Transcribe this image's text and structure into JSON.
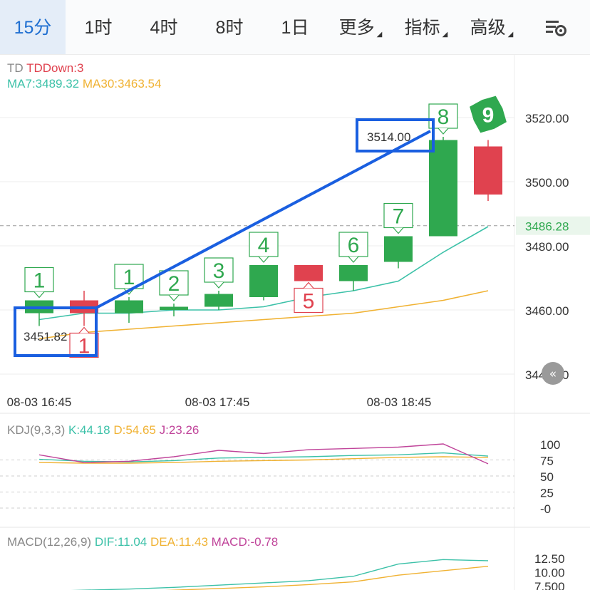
{
  "tabs": [
    {
      "label": "15分",
      "active": true
    },
    {
      "label": "1时"
    },
    {
      "label": "4时"
    },
    {
      "label": "8时"
    },
    {
      "label": "1日"
    },
    {
      "label": "更多",
      "dropdown": true
    },
    {
      "label": "指标",
      "dropdown": true
    },
    {
      "label": "高级",
      "dropdown": true
    }
  ],
  "settings_icon": "chart-settings-icon",
  "main_panel": {
    "td_label": "TD",
    "td_value": "TDDown:3",
    "ma7": "MA7:3489.32",
    "ma30": "MA30:3463.54",
    "last_price": "3486.28",
    "y_labels": [
      "3520.00",
      "3500.00",
      "3480.00",
      "3460.00",
      "3440.00"
    ],
    "x_labels": [
      "08-03 16:45",
      "08-03 17:45",
      "08-03 18:45"
    ],
    "annotation_low": "3451.82",
    "annotation_high": "3514.00"
  },
  "kdj_panel": {
    "title": "KDJ(9,3,3)",
    "k": "K:44.18",
    "d": "D:54.65",
    "j": "J:23.26",
    "y_labels": [
      "100",
      "75",
      "50",
      "25",
      "-0"
    ]
  },
  "macd_panel": {
    "title": "MACD(12,26,9)",
    "dif": "DIF:11.04",
    "dea": "DEA:11.43",
    "macd": "MACD:-0.78",
    "y_labels": [
      "12.50",
      "10.00",
      "7.500"
    ]
  },
  "colors": {
    "up": "#2fa84f",
    "down": "#e0424f",
    "ma7": "#3cc1a8",
    "ma30": "#f0b233",
    "kdj_j": "#c0449a",
    "accent": "#1f6fd1",
    "annotation_box": "#1a5fe0"
  },
  "chart_data": {
    "type": "candlestick",
    "price_axis": {
      "min": 3440,
      "max": 3520
    },
    "candles": [
      {
        "open": 3459,
        "high": 3463,
        "low": 3455,
        "close": 3463,
        "td": "1",
        "td_side": "up"
      },
      {
        "open": 3463,
        "high": 3466,
        "low": 3455,
        "close": 3459,
        "td": "1",
        "td_side": "down"
      },
      {
        "open": 3459,
        "high": 3464,
        "low": 3456,
        "close": 3463,
        "td": "1",
        "td_side": "up"
      },
      {
        "open": 3460,
        "high": 3462,
        "low": 3458,
        "close": 3461,
        "td": "2",
        "td_side": "up"
      },
      {
        "open": 3461,
        "high": 3466,
        "low": 3460,
        "close": 3465,
        "td": "3",
        "td_side": "up"
      },
      {
        "open": 3464,
        "high": 3474,
        "low": 3463,
        "close": 3474,
        "td": "4",
        "td_side": "up"
      },
      {
        "open": 3474,
        "high": 3474,
        "low": 3469,
        "close": 3469,
        "td": "5",
        "td_side": "down"
      },
      {
        "open": 3469,
        "high": 3474,
        "low": 3466,
        "close": 3474,
        "td": "6",
        "td_side": "up"
      },
      {
        "open": 3475,
        "high": 3483,
        "low": 3473,
        "close": 3483,
        "td": "7",
        "td_side": "up"
      },
      {
        "open": 3483,
        "high": 3514,
        "low": 3483,
        "close": 3513,
        "td": "8",
        "td_side": "up"
      },
      {
        "open": 3511,
        "high": 3513,
        "low": 3494,
        "close": 3496,
        "td": "9",
        "td_side": "up",
        "td_final": true
      }
    ],
    "ma7": [
      3457,
      3459,
      3459,
      3460,
      3460,
      3461,
      3464,
      3466,
      3469,
      3478,
      3486
    ],
    "ma30": [
      3451,
      3453,
      3454,
      3455,
      3456,
      3457,
      3458,
      3459,
      3461,
      3463,
      3466
    ],
    "kdj": {
      "k": [
        76,
        73,
        72,
        74,
        78,
        79,
        80,
        82,
        83,
        86,
        81
      ],
      "d": [
        71,
        70,
        70,
        71,
        73,
        74,
        75,
        77,
        79,
        80,
        79
      ],
      "j": [
        83,
        71,
        73,
        80,
        90,
        85,
        91,
        93,
        95,
        100,
        69
      ],
      "ylim": [
        0,
        100
      ]
    },
    "macd": {
      "dif": [
        6.5,
        6.7,
        6.9,
        7.2,
        7.6,
        8.0,
        8.4,
        9.2,
        11.4,
        12.2,
        12.0
      ],
      "dea": [
        6.0,
        6.2,
        6.4,
        6.7,
        7.0,
        7.3,
        7.7,
        8.2,
        9.4,
        10.2,
        11.0
      ],
      "ylim": [
        6.8,
        13.5
      ]
    },
    "x_ticks": [
      "08-03 16:45",
      "08-03 17:45",
      "08-03 18:45"
    ]
  }
}
